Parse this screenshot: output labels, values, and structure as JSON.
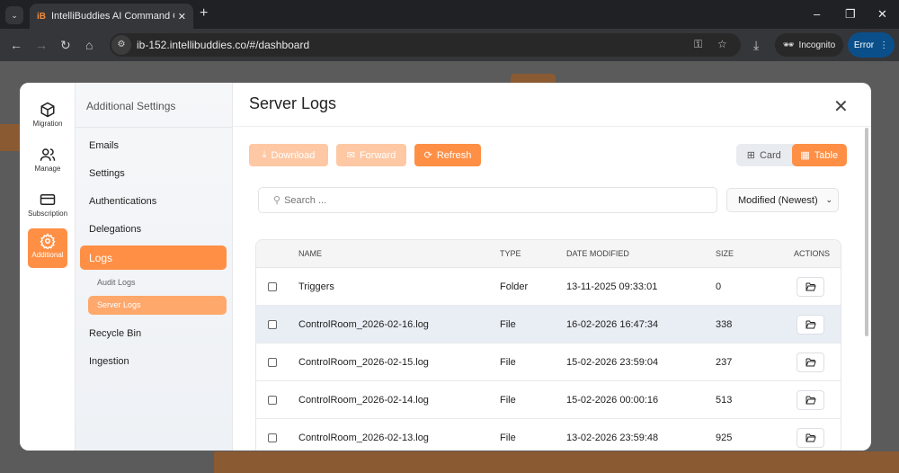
{
  "browser": {
    "tab_title": "IntelliBuddies AI Command Cen",
    "url": "ib-152.intellibuddies.co/#/dashboard",
    "incognito_label": "Incognito",
    "error_label": "Error"
  },
  "rail": [
    {
      "label": "Migration",
      "icon": "box-icon"
    },
    {
      "label": "Manage",
      "icon": "users-icon"
    },
    {
      "label": "Subscription",
      "icon": "credit-card-icon"
    },
    {
      "label": "Additional",
      "icon": "gear-icon",
      "active": true
    }
  ],
  "sidebar": {
    "title": "Additional Settings",
    "items": [
      "Emails",
      "Settings",
      "Authentications",
      "Delegations",
      "Logs",
      "Recycle Bin",
      "Ingestion"
    ],
    "sub_items": [
      "Audit Logs",
      "Server Logs"
    ]
  },
  "main": {
    "title": "Server Logs",
    "toolbar": {
      "download": "Download",
      "forward": "Forward",
      "refresh": "Refresh",
      "card": "Card",
      "table": "Table"
    },
    "search_placeholder": "Search ...",
    "sort_value": "Modified (Newest)",
    "columns": [
      "NAME",
      "TYPE",
      "DATE MODIFIED",
      "SIZE",
      "ACTIONS"
    ],
    "rows": [
      {
        "name": "Triggers",
        "type": "Folder",
        "date": "13-11-2025 09:33:01",
        "size": "0"
      },
      {
        "name": "ControlRoom_2026-02-16.log",
        "type": "File",
        "date": "16-02-2026 16:47:34",
        "size": "338"
      },
      {
        "name": "ControlRoom_2026-02-15.log",
        "type": "File",
        "date": "15-02-2026 23:59:04",
        "size": "237"
      },
      {
        "name": "ControlRoom_2026-02-14.log",
        "type": "File",
        "date": "15-02-2026 00:00:16",
        "size": "513"
      },
      {
        "name": "ControlRoom_2026-02-13.log",
        "type": "File",
        "date": "13-02-2026 23:59:48",
        "size": "925"
      }
    ]
  },
  "colors": {
    "accent": "#fe8f45",
    "accent_light": "#fec8a4"
  }
}
